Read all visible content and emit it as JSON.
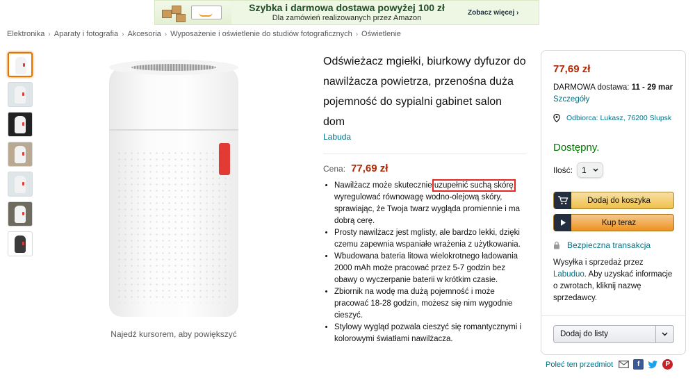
{
  "banner": {
    "title": "Szybka i darmowa dostawa powyżej 100 zł",
    "subtitle": "Dla zamówień realizowanych przez Amazon",
    "cta": "Zobacz więcej ›"
  },
  "breadcrumb": [
    "Elektronika",
    "Aparaty i fotografia",
    "Akcesoria",
    "Wyposażenie i oświetlenie do studiów fotograficznych",
    "Oświetlenie"
  ],
  "gallery": {
    "zoom_hint": "Najedź kursorem, aby powiększyć"
  },
  "product": {
    "title": "Odświeżacz mgiełki, biurkowy dyfuzor do nawilżacza powietrza, przenośna duża pojemność do sypialni gabinet salon dom",
    "brand": "Labuda",
    "price_label": "Cena:",
    "price": "77,69 zł",
    "bullets": [
      {
        "before": "Nawilżacz może skutecznie ",
        "highlight": "uzupełnić suchą skórę",
        "after": ", wyregulować równowagę wodno-olejową skóry, sprawiając, że Twoja twarz wygląda promiennie i ma dobrą cerę."
      },
      {
        "text": "Prosty nawilżacz jest mglisty, ale bardzo lekki, dzięki czemu zapewnia wspaniałe wrażenia z użytkowania."
      },
      {
        "text": "Wbudowana bateria litowa wielokrotnego ładowania 2000 mAh może pracować przez 5-7 godzin bez obawy o wyczerpanie baterii w krótkim czasie."
      },
      {
        "text": "Zbiornik na wodę ma dużą pojemność i może pracować 18-28 godzin, możesz się nim wygodnie cieszyć."
      },
      {
        "text": "Stylowy wygląd pozwala cieszyć się romantycznymi i kolorowymi światłami nawilżacza."
      }
    ]
  },
  "buybox": {
    "price": "77,69 zł",
    "delivery_prefix": "DARMOWA dostawa: ",
    "delivery_date": "11 - 29 mar",
    "delivery_details": "Szczegóły",
    "location": "Odbiorca: Lukasz, 76200 Slupsk",
    "stock": "Dostępny.",
    "qty_label": "Ilość:",
    "qty_value": "1",
    "add_to_cart": "Dodaj do koszyka",
    "buy_now": "Kup teraz",
    "secure": "Bezpieczna transakcja",
    "seller_prefix": "Wysyłka i sprzedaż przez ",
    "seller_name": "Labuduo",
    "seller_suffix": ". Aby uzyskać informacje o zwrotach, kliknij nazwę sprzedawcy.",
    "add_to_list": "Dodaj do listy"
  },
  "share": {
    "label": "Poleć ten przedmiot",
    "icons": [
      "email-icon",
      "facebook-icon",
      "twitter-icon",
      "pinterest-icon"
    ]
  },
  "colors": {
    "price": "#b12704",
    "link": "#007185",
    "stock": "#007600",
    "cart_button": "#f0c14b",
    "buy_button": "#ed9220",
    "highlight_box": "#e6261f"
  }
}
